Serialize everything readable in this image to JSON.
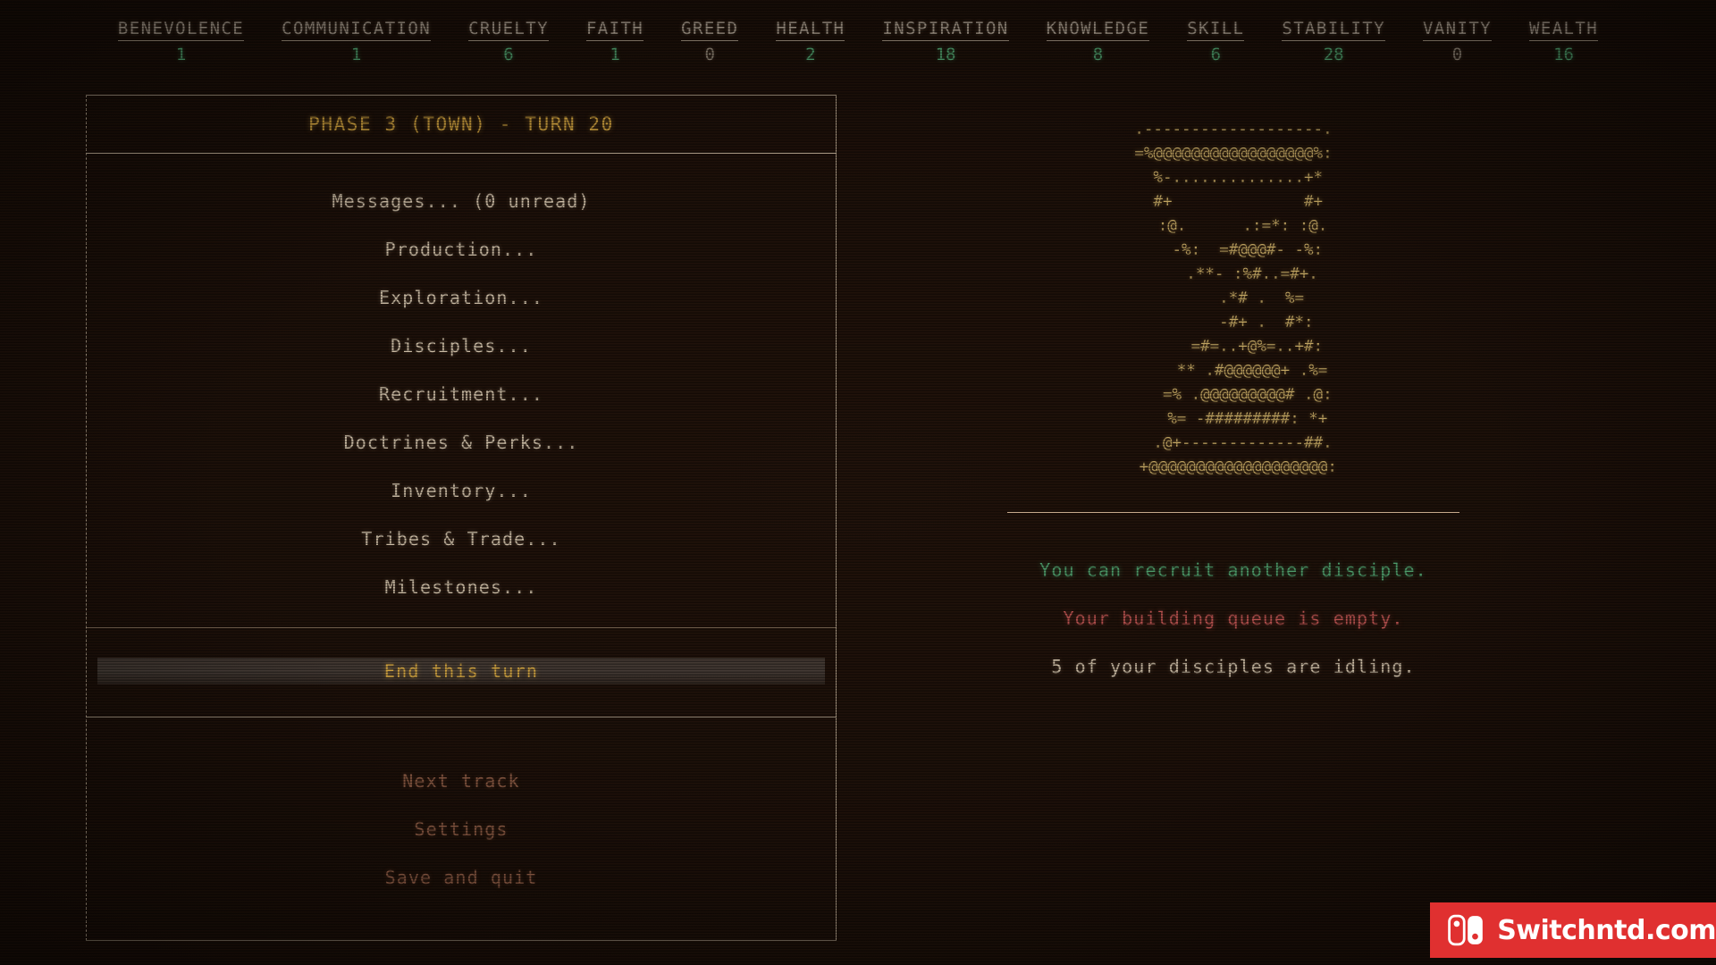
{
  "stats": [
    {
      "label": "BENEVOLENCE",
      "value": "1"
    },
    {
      "label": "COMMUNICATION",
      "value": "1"
    },
    {
      "label": "CRUELTY",
      "value": "6"
    },
    {
      "label": "FAITH",
      "value": "1"
    },
    {
      "label": "GREED",
      "value": "0"
    },
    {
      "label": "HEALTH",
      "value": "2"
    },
    {
      "label": "INSPIRATION",
      "value": "18"
    },
    {
      "label": "KNOWLEDGE",
      "value": "8"
    },
    {
      "label": "SKILL",
      "value": "6"
    },
    {
      "label": "STABILITY",
      "value": "28"
    },
    {
      "label": "VANITY",
      "value": "0"
    },
    {
      "label": "WEALTH",
      "value": "16"
    }
  ],
  "left_panel": {
    "phase_title": "PHASE 3 (TOWN) - TURN 20",
    "menu_items": [
      {
        "label": "Messages... (0 unread)"
      },
      {
        "label": "Production..."
      },
      {
        "label": "Exploration..."
      },
      {
        "label": "Disciples..."
      },
      {
        "label": "Recruitment..."
      },
      {
        "label": "Doctrines & Perks..."
      },
      {
        "label": "Inventory..."
      },
      {
        "label": "Tribes & Trade..."
      },
      {
        "label": "Milestones..."
      }
    ],
    "end_turn_label": "End this turn",
    "footer_items": [
      {
        "label": "Next track"
      },
      {
        "label": "Settings"
      },
      {
        "label": "Save and quit"
      }
    ]
  },
  "right_panel": {
    "ascii_art": ".-------------------.\n=%@@@@@@@@@@@@@@@@@%:\n %-..............+*\n #+              #+\n  :@.      .:=*: :@.\n   -%:  =#@@@#- -%:\n    .**- :%#..=#+.\n      .*# .  %=\n       -#+ .  #*:\n     =#=..+@%=..+#:\n    ** .#@@@@@@+ .%=\n   =% .@@@@@@@@@# .@:\n   %= -#########: *+\n  .@+-------------##.\n +@@@@@@@@@@@@@@@@@@@:",
    "status_lines": [
      {
        "text": "You can recruit another disciple.",
        "tone": "good"
      },
      {
        "text": "Your building queue is empty.",
        "tone": "bad"
      },
      {
        "text": "5 of your disciples are idling.",
        "tone": "neutral"
      }
    ]
  },
  "watermark": {
    "text": "Switchntd.com",
    "color": "#e03030"
  },
  "colors": {
    "background": "#1a0e08",
    "accent_gold": "#c89b3c",
    "text_tan": "#cbbba4",
    "good_green": "#4f9d6b",
    "bad_red": "#b8524f",
    "dim_brown": "#8b5a43",
    "border": "#ab9a85"
  }
}
